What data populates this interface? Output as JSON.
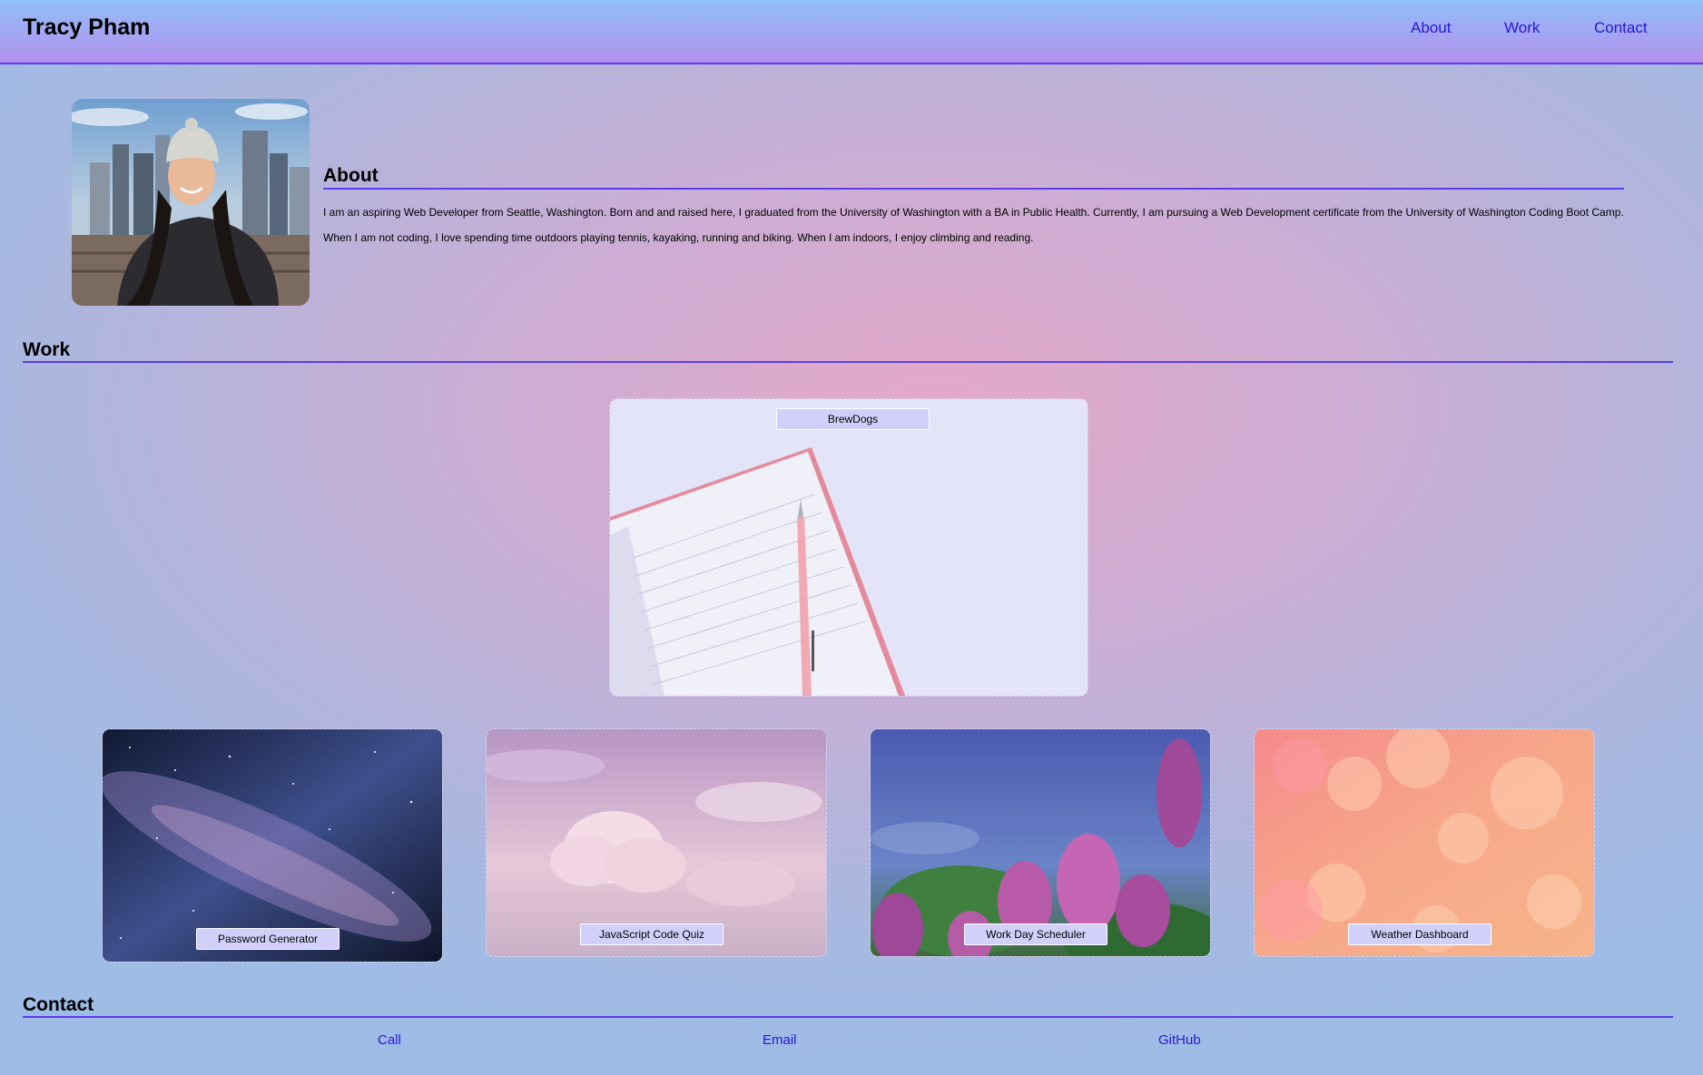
{
  "header": {
    "brand": "Tracy Pham",
    "nav": [
      "About",
      "Work",
      "Contact"
    ]
  },
  "about": {
    "title": "About",
    "paragraphs": [
      "I am an aspiring Web Developer from Seattle, Washington. Born and and raised here, I graduated from the University of Washington with a BA in Public Health. Currently, I am pursuing a Web Development certificate from the University of Washington Coding Boot Camp.",
      "When I am not coding, I love spending time outdoors playing tennis, kayaking, running and biking. When I am indoors, I enjoy climbing and reading."
    ]
  },
  "work": {
    "title": "Work",
    "featured": {
      "label": "BrewDogs",
      "image": "notebook-pen-photo"
    },
    "projects": [
      {
        "label": "Password Generator",
        "image": "milky-way-photo"
      },
      {
        "label": "JavaScript Code Quiz",
        "image": "pink-clouds-photo"
      },
      {
        "label": "Work Day Scheduler",
        "image": "lilac-flowers-photo"
      },
      {
        "label": "Weather Dashboard",
        "image": "bokeh-lights-photo"
      }
    ]
  },
  "contact": {
    "title": "Contact",
    "links": [
      "Call",
      "Email",
      "GitHub"
    ]
  },
  "colors": {
    "accent": "#5b3cf0",
    "link": "#2a16d8",
    "label_bg": "#d2d0fa"
  }
}
